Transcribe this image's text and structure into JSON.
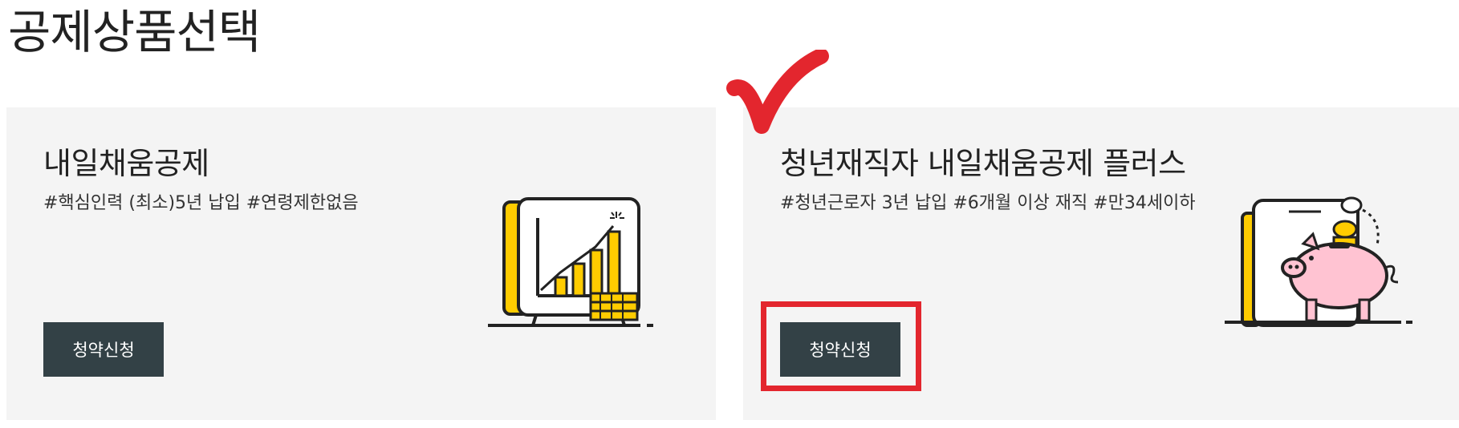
{
  "page": {
    "title": "공제상품선택"
  },
  "cards": [
    {
      "title": "내일채움공제",
      "tags": "#핵심인력 (최소)5년 납입 #연령제한없음",
      "button_label": "청약신청",
      "illustration_icon": "growth-chart-icon"
    },
    {
      "title": "청년재직자 내일채움공제 플러스",
      "tags": "#청년근로자 3년 납입 #6개월 이상 재직 #만34세이하",
      "button_label": "청약신청",
      "illustration_icon": "piggy-bank-icon"
    }
  ],
  "annotations": {
    "highlight_color": "#e3262e",
    "check_icon": "checkmark-icon"
  },
  "colors": {
    "card_bg": "#f4f4f4",
    "button_bg": "#334146",
    "accent_yellow": "#ffcc00",
    "piggy_pink": "#ffc3d2"
  }
}
